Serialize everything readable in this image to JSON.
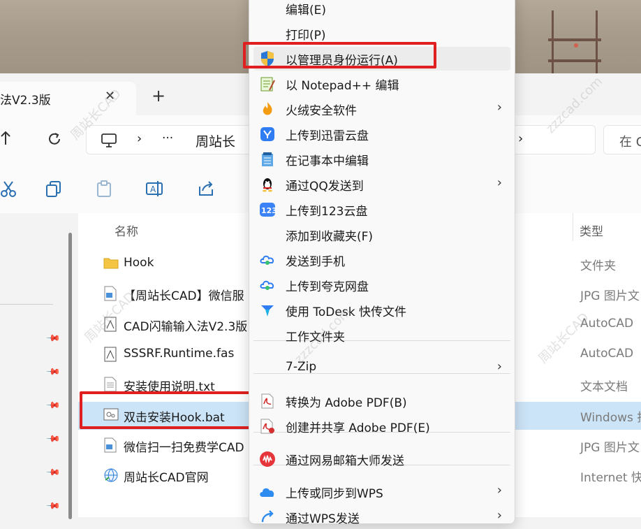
{
  "window": {
    "tab_title": "法V2.3版",
    "tab_close": "✕",
    "tab_add": "+",
    "breadcrumb_more": "···",
    "breadcrumb_item": "周站长",
    "breadcrumb_sep": "›",
    "search_placeholder": "在 C"
  },
  "columns": {
    "name": "名称",
    "type": "类型"
  },
  "files": [
    {
      "name": "Hook",
      "type": "文件夹",
      "icon": "folder-icon"
    },
    {
      "name": "【周站长CAD】微信服",
      "type": "JPG 图片文",
      "icon": "jpg-file-icon"
    },
    {
      "name": "CAD闪输输入法V2.3版",
      "type": "AutoCAD",
      "icon": "cad-file-icon"
    },
    {
      "name": "SSSRF.Runtime.fas",
      "type": "AutoCAD",
      "icon": "fas-file-icon"
    },
    {
      "name": "安装使用说明.txt",
      "type": "文本文档",
      "icon": "txt-file-icon"
    },
    {
      "name": "双击安装Hook.bat",
      "type": "Windows 批",
      "icon": "bat-file-icon",
      "selected": true
    },
    {
      "name": "微信扫一扫免费学CAD",
      "type": "JPG 图片文",
      "icon": "jpg-file-icon"
    },
    {
      "name": "周站长CAD官网",
      "type": "Internet 快",
      "icon": "url-file-icon"
    }
  ],
  "context_menu": [
    {
      "label": "编辑(E)"
    },
    {
      "label": "打印(P)"
    },
    {
      "label": "以管理员身份运行(A)",
      "icon": "uac-shield-icon",
      "highlighted": true
    },
    {
      "label": "以 Notepad++ 编辑",
      "icon": "notepadpp-icon"
    },
    {
      "label": "火绒安全软件",
      "icon": "huorong-icon",
      "submenu": true
    },
    {
      "label": "上传到迅雷云盘",
      "icon": "xunlei-icon"
    },
    {
      "label": "在记事本中编辑",
      "icon": "notepad-icon"
    },
    {
      "label": "通过QQ发送到",
      "icon": "qq-icon",
      "submenu": true
    },
    {
      "label": "上传到123云盘",
      "icon": "pan123-icon"
    },
    {
      "label": "添加到收藏夹(F)"
    },
    {
      "label": "发送到手机",
      "icon": "quark-icon"
    },
    {
      "label": "上传到夸克网盘",
      "icon": "quark-cloud-icon"
    },
    {
      "label": "使用 ToDesk 快传文件",
      "icon": "todesk-icon"
    },
    {
      "label": "工作文件夹"
    },
    {
      "label": "7-Zip",
      "submenu": true
    },
    {
      "label": "转换为 Adobe PDF(B)",
      "icon": "adobe-pdf-icon"
    },
    {
      "label": "创建并共享 Adobe PDF(E)",
      "icon": "adobe-share-icon"
    },
    {
      "label": "通过网易邮箱大师发送",
      "icon": "netease-mail-icon"
    },
    {
      "label": "上传或同步到WPS",
      "icon": "wps-cloud-icon",
      "submenu": true
    },
    {
      "label": "通过WPS发送",
      "icon": "wps-send-icon",
      "submenu": true
    }
  ],
  "submenu_arrow": "›",
  "colors": {
    "highlight_box": "#e02020",
    "selected_row": "#cce4f7"
  }
}
